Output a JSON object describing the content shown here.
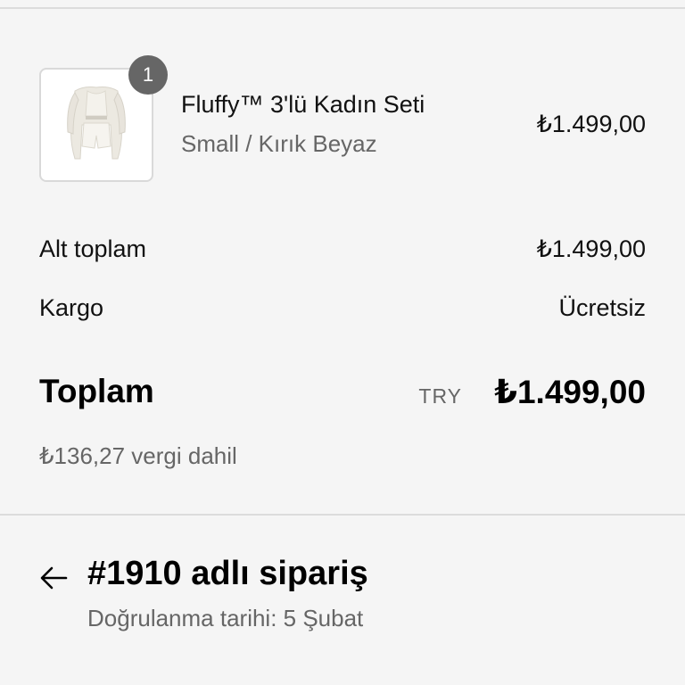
{
  "line_item": {
    "quantity": "1",
    "title": "Fluffy™ 3'lü Kadın Seti",
    "variant": "Small / Kırık Beyaz",
    "price": "₺1.499,00",
    "image_icon": "clothing-set-image"
  },
  "summary": {
    "subtotal_label": "Alt toplam",
    "subtotal_value": "₺1.499,00",
    "shipping_label": "Kargo",
    "shipping_value": "Ücretsiz",
    "total_label": "Toplam",
    "total_currency": "TRY",
    "total_value": "₺1.499,00",
    "tax_note": "₺136,27 vergi dahil"
  },
  "order": {
    "back_icon": "arrow-left-icon",
    "title": "#1910 adlı sipariş",
    "confirmation": "Doğrulanma tarihi: 5 Şubat"
  },
  "colors": {
    "background": "#f5f5f5",
    "badge": "#666666",
    "muted_text": "#666666",
    "divider": "#dcdcdc"
  }
}
